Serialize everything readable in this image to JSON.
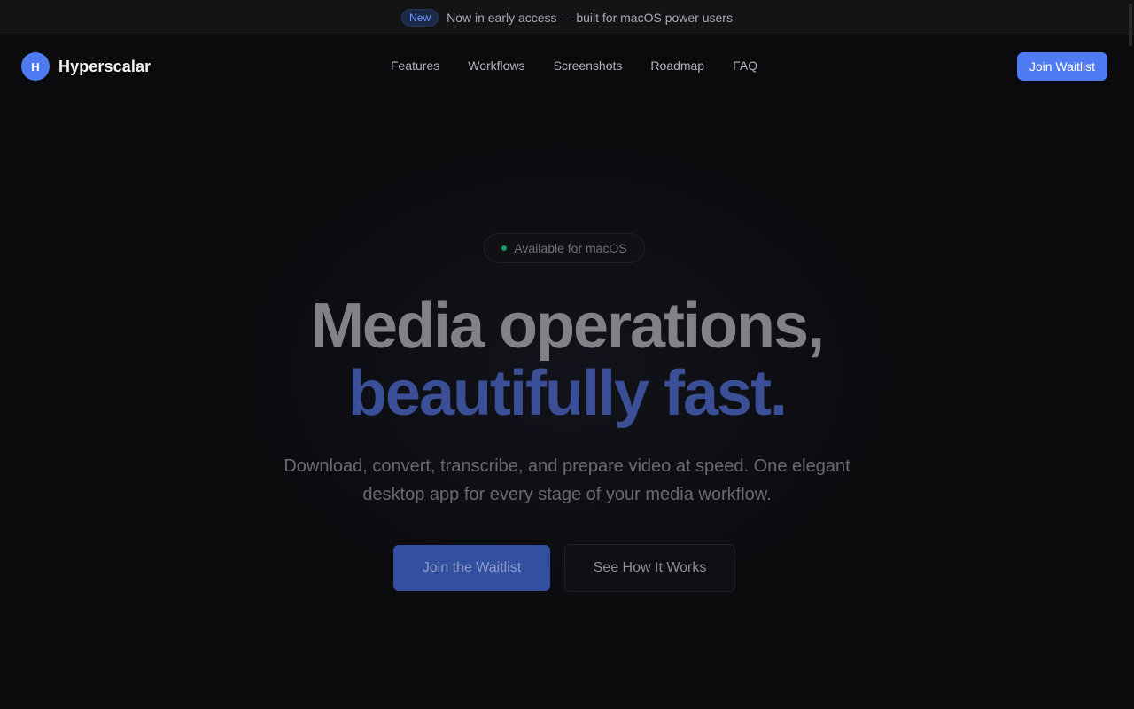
{
  "announcement": {
    "badge": "New",
    "text": "Now in early access — built for macOS power users"
  },
  "header": {
    "logo_letter": "H",
    "brand": "Hyperscalar",
    "nav": [
      "Features",
      "Workflows",
      "Screenshots",
      "Roadmap",
      "FAQ"
    ],
    "cta": "Join Waitlist"
  },
  "hero": {
    "pill": "Available for macOS",
    "headline_line1": "Media operations,",
    "headline_line2": "beautifully fast.",
    "subtitle": "Download, convert, transcribe, and prepare video at speed. One elegant desktop app for every stage of your media workflow.",
    "primary_button": "Join the Waitlist",
    "secondary_button": "See How It Works"
  },
  "colors": {
    "accent": "#4f7bf2",
    "background": "#0b0b0d",
    "status_dot": "#1a9b62"
  }
}
